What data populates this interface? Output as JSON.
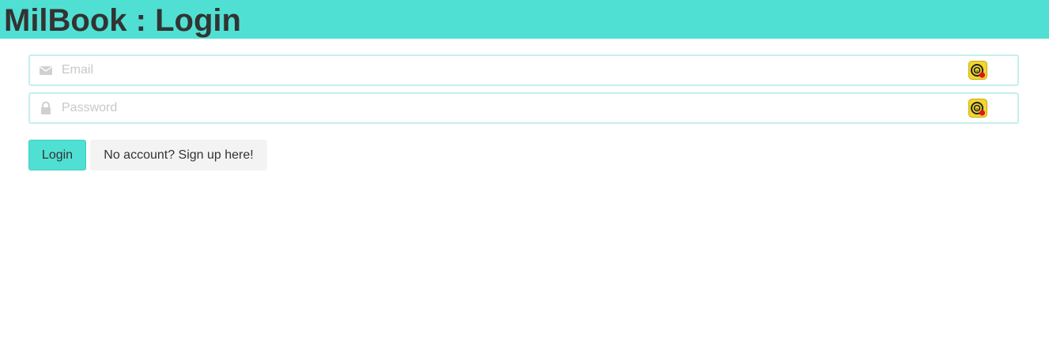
{
  "header": {
    "title": "MilBook : Login",
    "background_color": "#4fe0d3"
  },
  "form": {
    "email": {
      "placeholder": "Email",
      "value": "",
      "icon": "envelope-icon"
    },
    "password": {
      "placeholder": "Password",
      "value": "",
      "icon": "lock-icon"
    },
    "extension_icon": "password-manager-extension-icon"
  },
  "buttons": {
    "login_label": "Login",
    "signup_label": "No account? Sign up here!"
  },
  "colors": {
    "accent": "#4fe0d3",
    "text": "#333333",
    "field_border": "#c6eeee",
    "secondary_button": "#f3f3f3"
  }
}
